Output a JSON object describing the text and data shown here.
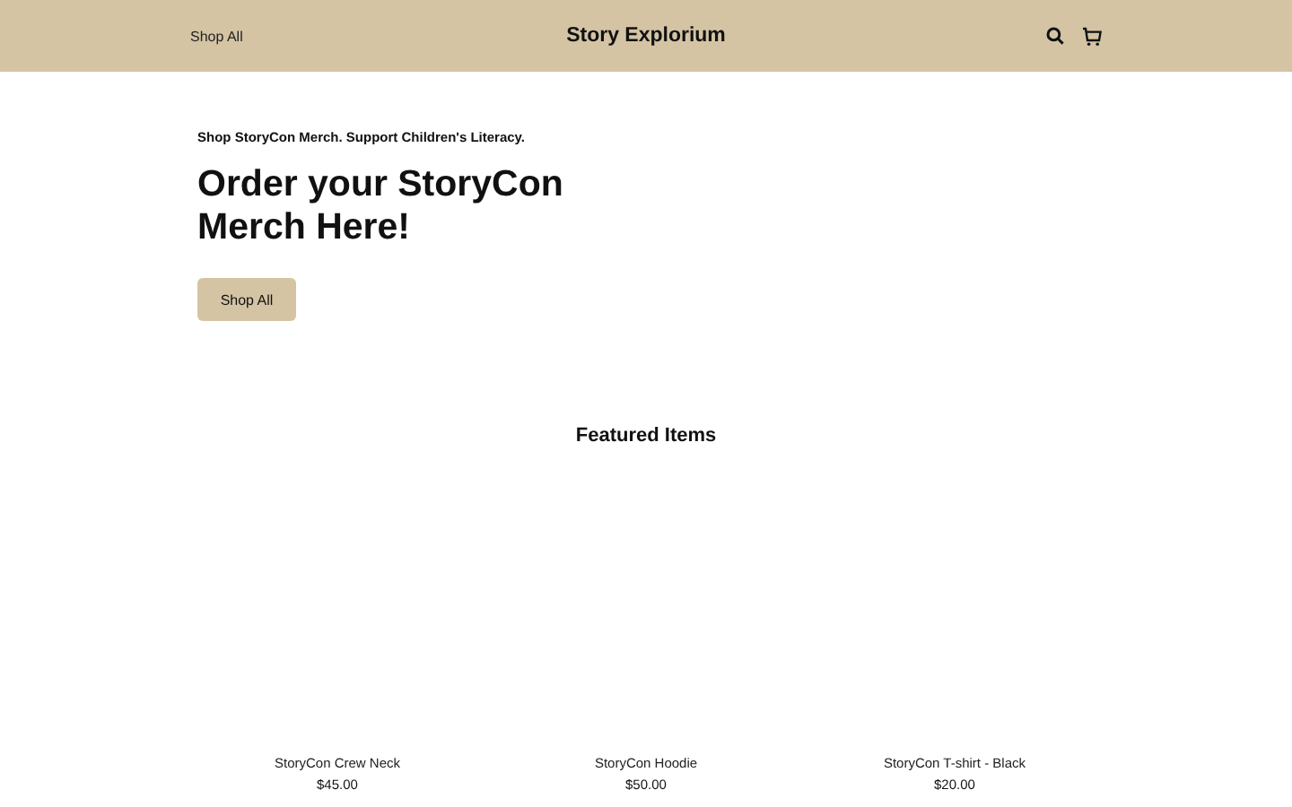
{
  "header": {
    "nav_link": "Shop All",
    "brand": "Story Explorium"
  },
  "hero": {
    "eyebrow": "Shop StoryCon Merch. Support Children's Literacy.",
    "title": "Order your StoryCon Merch Here!",
    "button": "Shop All"
  },
  "featured": {
    "title": "Featured Items",
    "products": [
      {
        "name": "StoryCon Crew Neck",
        "price": "$45.00"
      },
      {
        "name": "StoryCon Hoodie",
        "price": "$50.00"
      },
      {
        "name": "StoryCon T-shirt - Black",
        "price": "$20.00"
      }
    ]
  }
}
